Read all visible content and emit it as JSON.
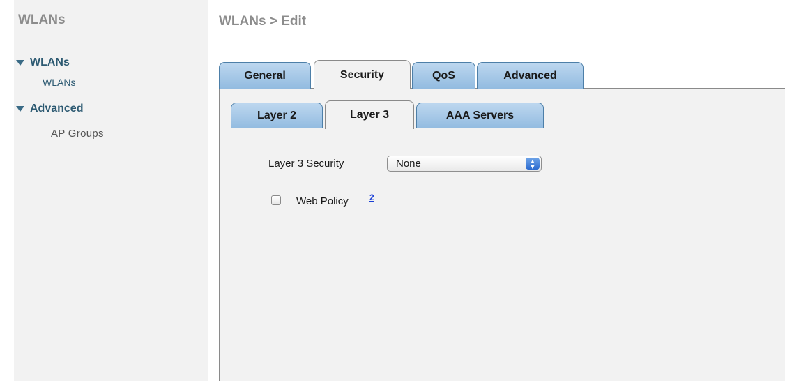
{
  "sidebar": {
    "title": "WLANs",
    "groups": [
      {
        "label": "WLANs",
        "items": [
          {
            "label": "WLANs"
          }
        ]
      },
      {
        "label": "Advanced",
        "items": [
          {
            "label": "AP Groups"
          }
        ]
      }
    ]
  },
  "main": {
    "title": "WLANs > Edit",
    "tabs": [
      {
        "label": "General"
      },
      {
        "label": "Security",
        "active": true
      },
      {
        "label": "QoS"
      },
      {
        "label": "Advanced"
      }
    ],
    "subtabs": [
      {
        "label": "Layer 2"
      },
      {
        "label": "Layer 3",
        "active": true
      },
      {
        "label": "AAA Servers"
      }
    ],
    "layer3_security": {
      "label": "Layer 3 Security",
      "value": "None"
    },
    "web_policy": {
      "label": "Web Policy",
      "footnote": "2",
      "checked": false
    }
  },
  "colors": {
    "tab_blue": "#92bbe0",
    "nav_text": "#2d5a72",
    "panel_bg": "#f2f2f2",
    "title_gray": "#8c8c8c"
  }
}
